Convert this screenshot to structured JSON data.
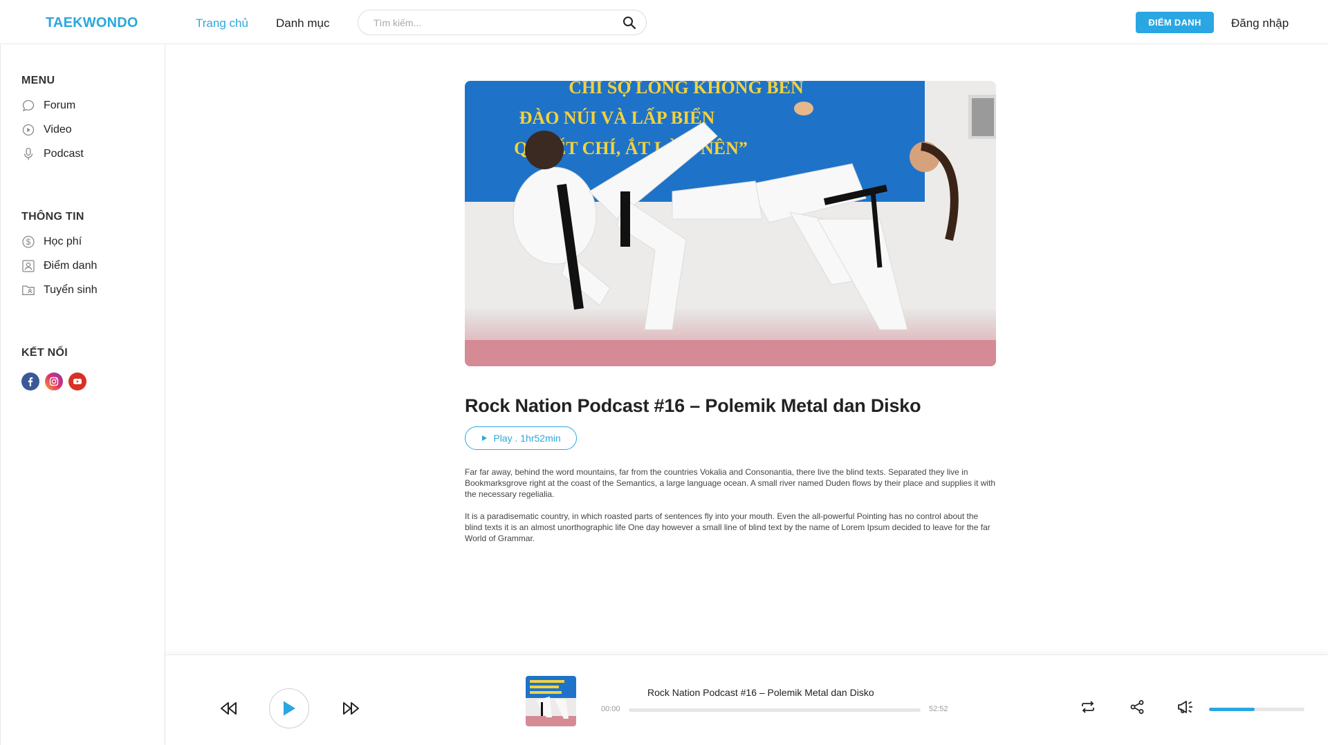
{
  "brand": {
    "name": "TAEKWONDO",
    "accent": "#2aa7dd"
  },
  "nav": {
    "home": "Trang chủ",
    "categories": "Danh mục"
  },
  "search": {
    "placeholder": "Tìm kiếm..."
  },
  "header": {
    "attend_button": "ĐIỂM DANH",
    "login": "Đăng nhập"
  },
  "sidebar": {
    "menu_title": "MENU",
    "menu_items": [
      {
        "label": "Forum",
        "icon": "chat-bubble-icon"
      },
      {
        "label": "Video",
        "icon": "play-circle-icon"
      },
      {
        "label": "Podcast",
        "icon": "microphone-icon"
      }
    ],
    "info_title": "THÔNG TIN",
    "info_items": [
      {
        "label": "Học phí",
        "icon": "dollar-circle-icon"
      },
      {
        "label": "Điểm danh",
        "icon": "id-card-icon"
      },
      {
        "label": "Tuyển sinh",
        "icon": "folder-user-icon"
      }
    ],
    "connect_title": "KẾT NỐI",
    "social": [
      {
        "icon": "facebook-icon",
        "color": "#3b5998"
      },
      {
        "icon": "instagram-icon",
        "color": "#e1306c"
      },
      {
        "icon": "youtube-icon",
        "color": "#d93025"
      }
    ]
  },
  "post": {
    "banner_lines": [
      "CHỈ SỢ LÒNG KHÔNG BỀN",
      "ĐÀO NÚI VÀ LẤP BIỂN",
      "QUYẾT CHÍ, ẮT LÀM NÊN”"
    ],
    "title": "Rock Nation Podcast #16 – Polemik Metal dan Disko",
    "play_label": "Play . 1hr52min",
    "paragraphs": [
      "Far far away, behind the word mountains, far from the countries Vokalia and Consonantia, there live the blind texts. Separated they live in Bookmarksgrove right at the coast of the Semantics, a large language ocean. A small river named Duden flows by their place and supplies it with the necessary regelialia.",
      "It is a paradisematic country, in which roasted parts of sentences fly into your mouth. Even the all-powerful Pointing has no control about the blind texts it is an almost unorthographic life One day however a small line of blind text by the name of Lorem Ipsum decided to leave for the far World of Grammar."
    ]
  },
  "player": {
    "track_title": "Rock Nation Podcast #16 – Polemik Metal dan Disko",
    "current_time": "00:00",
    "total_time": "52:52",
    "progress": 0,
    "volume": 0.48
  }
}
